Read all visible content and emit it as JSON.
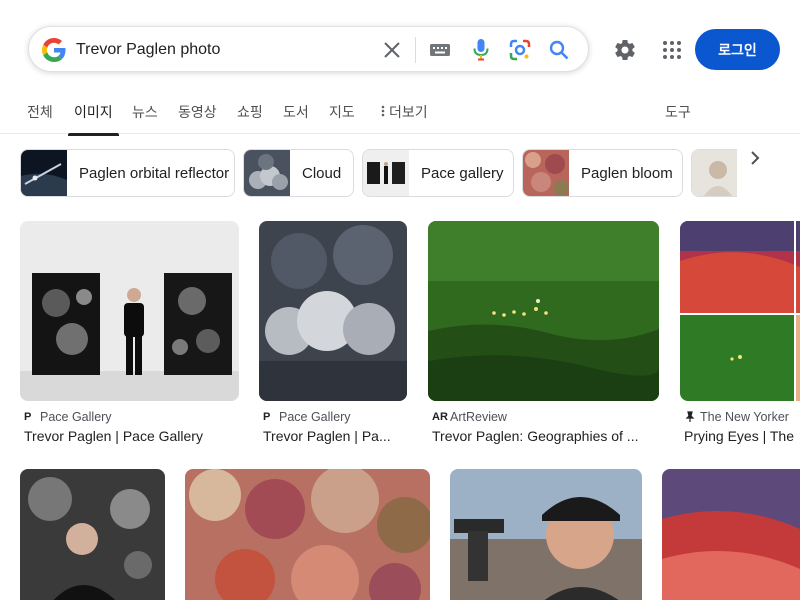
{
  "search": {
    "query": "Trevor Paglen photo"
  },
  "header": {
    "login_label": "로그인"
  },
  "tabs": [
    {
      "label": "전체"
    },
    {
      "label": "이미지"
    },
    {
      "label": "뉴스"
    },
    {
      "label": "동영상"
    },
    {
      "label": "쇼핑"
    },
    {
      "label": "도서"
    },
    {
      "label": "지도"
    },
    {
      "label": "더보기"
    }
  ],
  "tools_label": "도구",
  "chips": [
    {
      "label": "Paglen orbital reflector"
    },
    {
      "label": "Cloud"
    },
    {
      "label": "Pace gallery"
    },
    {
      "label": "Paglen bloom"
    }
  ],
  "results": [
    {
      "source": "Pace Gallery",
      "source_icon": "P",
      "title": "Trevor Paglen | Pace Gallery"
    },
    {
      "source": "Pace Gallery",
      "source_icon": "P",
      "title": "Trevor Paglen | Pa..."
    },
    {
      "source": "ArtReview",
      "source_icon": "AR",
      "title": "Trevor Paglen: Geographies of ..."
    },
    {
      "source": "The New Yorker",
      "source_icon": "pin",
      "title": "Prying Eyes | The"
    }
  ],
  "colors": {
    "accent": "#0b57d0",
    "google_blue": "#4285f4",
    "google_red": "#ea4335",
    "google_yellow": "#fbbc05",
    "google_green": "#34a853"
  }
}
